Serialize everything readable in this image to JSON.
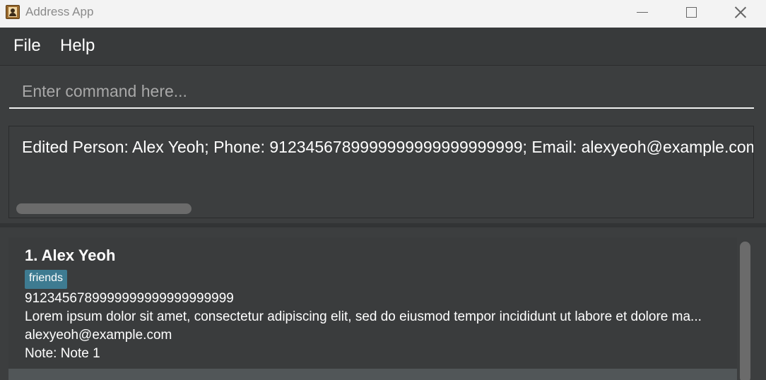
{
  "window": {
    "title": "Address App",
    "app_icon": "address-book-icon"
  },
  "menu": {
    "items": [
      "File",
      "Help"
    ]
  },
  "command": {
    "placeholder": "Enter command here...",
    "value": ""
  },
  "result": {
    "text": "Edited Person: Alex Yeoh; Phone: 9123456789999999999999999999; Email: alexyeoh@example.com"
  },
  "persons": [
    {
      "index_name": "1. Alex Yeoh",
      "tags": [
        "friends"
      ],
      "phone": "9123456789999999999999999999",
      "address": "Lorem ipsum dolor sit amet, consectetur adipiscing elit, sed do eiusmod tempor incididunt ut labore et dolore ma...",
      "email": "alexyeoh@example.com",
      "note": "Note: Note 1"
    }
  ],
  "colors": {
    "background": "#3c3e3f",
    "tag": "#3e7b91",
    "titlebar": "#f3f3f3"
  }
}
